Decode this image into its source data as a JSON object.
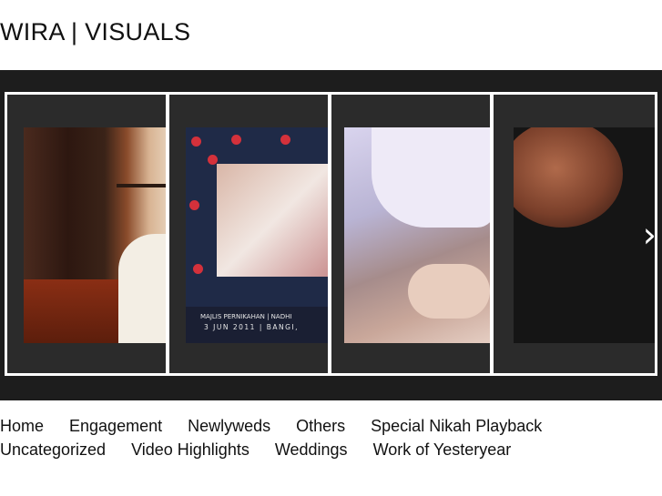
{
  "site": {
    "title": "WIRA | VISUALS"
  },
  "slider": {
    "slides": [
      {
        "icon": "photo-room-curtains"
      },
      {
        "icon": "photo-picture-frame",
        "caption_line1": "MAJLIS PERNIKAHAN | NADHI",
        "caption_line2": "3 JUN 2011 | BANGI,"
      },
      {
        "icon": "photo-bride-veil"
      },
      {
        "icon": "photo-face-portrait"
      }
    ],
    "next_icon": "chevron-right-icon",
    "next_glyph": "›"
  },
  "nav": {
    "row1": [
      "Home",
      "Engagement",
      "Newlyweds",
      "Others",
      "Special Nikah Playback"
    ],
    "row2": [
      "Uncategorized",
      "Video Highlights",
      "Weddings",
      "Work of Yesteryear"
    ]
  }
}
